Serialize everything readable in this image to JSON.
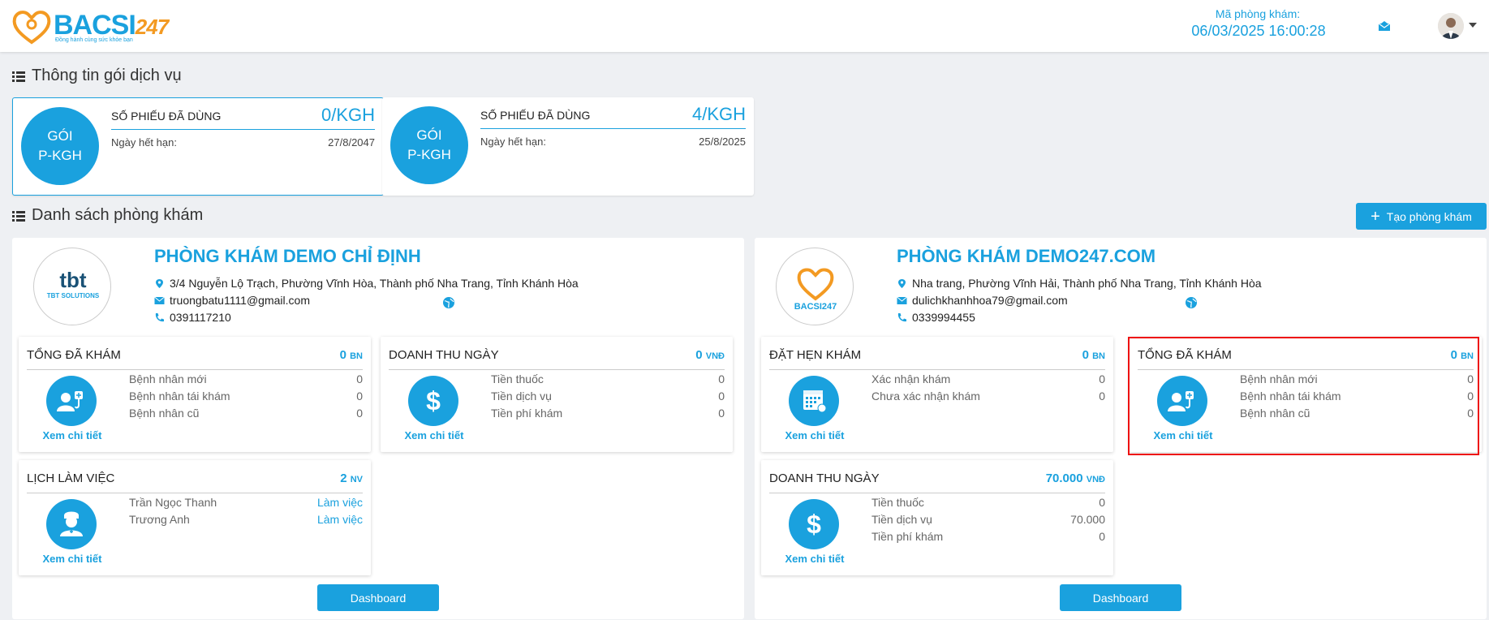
{
  "header": {
    "logo_text": "BACSI",
    "logo_num": "247",
    "logo_tagline": "Đồng hành cùng sức khỏe bạn",
    "clinic_code_label": "Mã phòng khám:",
    "datetime": "06/03/2025 16:00:28"
  },
  "packages": {
    "section_title": "Thông tin gói dịch vụ",
    "items": [
      {
        "circle": "GÓI P-KGH",
        "label": "SỐ PHIẾU ĐÃ DÙNG",
        "value": "0/KGH",
        "expiry_label": "Ngày hết hạn:",
        "expiry": "27/8/2047"
      },
      {
        "circle": "GÓI P-KGH",
        "label": "SỐ PHIẾU ĐÃ DÙNG",
        "value": "4/KGH",
        "expiry_label": "Ngày hết hạn:",
        "expiry": "25/8/2025"
      }
    ]
  },
  "clinics": {
    "section_title": "Danh sách phòng khám",
    "create_button": "Tạo phòng khám",
    "items": [
      {
        "name": "PHÒNG KHÁM DEMO CHỈ ĐỊNH",
        "logo_text": "TBT SOLUTIONS",
        "address": "3/4 Nguyễn Lộ Trạch, Phường Vĩnh Hòa, Thành phố Nha Trang, Tỉnh Khánh Hòa",
        "email": "truongbatu1111@gmail.com",
        "phone": "0391117210",
        "dashboard_button": "Dashboard",
        "cards": [
          {
            "title": "TỔNG ĐÃ KHÁM",
            "value": "0",
            "unit": "BN",
            "link": "Xem chi tiết",
            "icon": "doctor-patient-icon",
            "rows": [
              {
                "label": "Bệnh nhân mới",
                "value": "0"
              },
              {
                "label": "Bệnh nhân tái khám",
                "value": "0"
              },
              {
                "label": "Bệnh nhân cũ",
                "value": "0"
              }
            ]
          },
          {
            "title": "DOANH THU NGÀY",
            "value": "0",
            "unit": "VNĐ",
            "link": "Xem chi tiết",
            "icon": "dollar-icon",
            "rows": [
              {
                "label": "Tiền thuốc",
                "value": "0"
              },
              {
                "label": "Tiền dịch vụ",
                "value": "0"
              },
              {
                "label": "Tiền phí khám",
                "value": "0"
              }
            ]
          },
          {
            "title": "LỊCH LÀM VIỆC",
            "value": "2",
            "unit": "NV",
            "link": "Xem chi tiết",
            "icon": "nurse-icon",
            "rows": [
              {
                "label": "Trần Ngọc Thanh",
                "value": "Làm việc"
              },
              {
                "label": "Trương Anh",
                "value": "Làm việc"
              }
            ]
          }
        ]
      },
      {
        "name": "PHÒNG KHÁM DEMO247.COM",
        "logo_text": "BACSI247",
        "address": "Nha trang, Phường Vĩnh Hải, Thành phố Nha Trang, Tỉnh Khánh Hòa",
        "email": "dulichkhanhhoa79@gmail.com",
        "phone": "0339994455",
        "dashboard_button": "Dashboard",
        "cards": [
          {
            "title": "ĐẶT HẸN KHÁM",
            "value": "0",
            "unit": "BN",
            "link": "Xem chi tiết",
            "icon": "calendar-icon",
            "rows": [
              {
                "label": "Xác nhận khám",
                "value": "0"
              },
              {
                "label": "Chưa xác nhận khám",
                "value": "0"
              }
            ]
          },
          {
            "title": "TỔNG ĐÃ KHÁM",
            "value": "0",
            "unit": "BN",
            "link": "Xem chi tiết",
            "icon": "doctor-patient-icon",
            "rows": [
              {
                "label": "Bệnh nhân mới",
                "value": "0"
              },
              {
                "label": "Bệnh nhân tái khám",
                "value": "0"
              },
              {
                "label": "Bệnh nhân cũ",
                "value": "0"
              }
            ]
          },
          {
            "title": "DOANH THU NGÀY",
            "value": "70.000",
            "unit": "VNĐ",
            "link": "Xem chi tiết",
            "icon": "dollar-icon",
            "rows": [
              {
                "label": "Tiền thuốc",
                "value": "0"
              },
              {
                "label": "Tiền dịch vụ",
                "value": "70.000"
              },
              {
                "label": "Tiền phí khám",
                "value": "0"
              }
            ]
          }
        ]
      }
    ]
  },
  "colors": {
    "accent": "#1aa1de",
    "orange": "#f39a22",
    "highlight": "#e11111"
  }
}
